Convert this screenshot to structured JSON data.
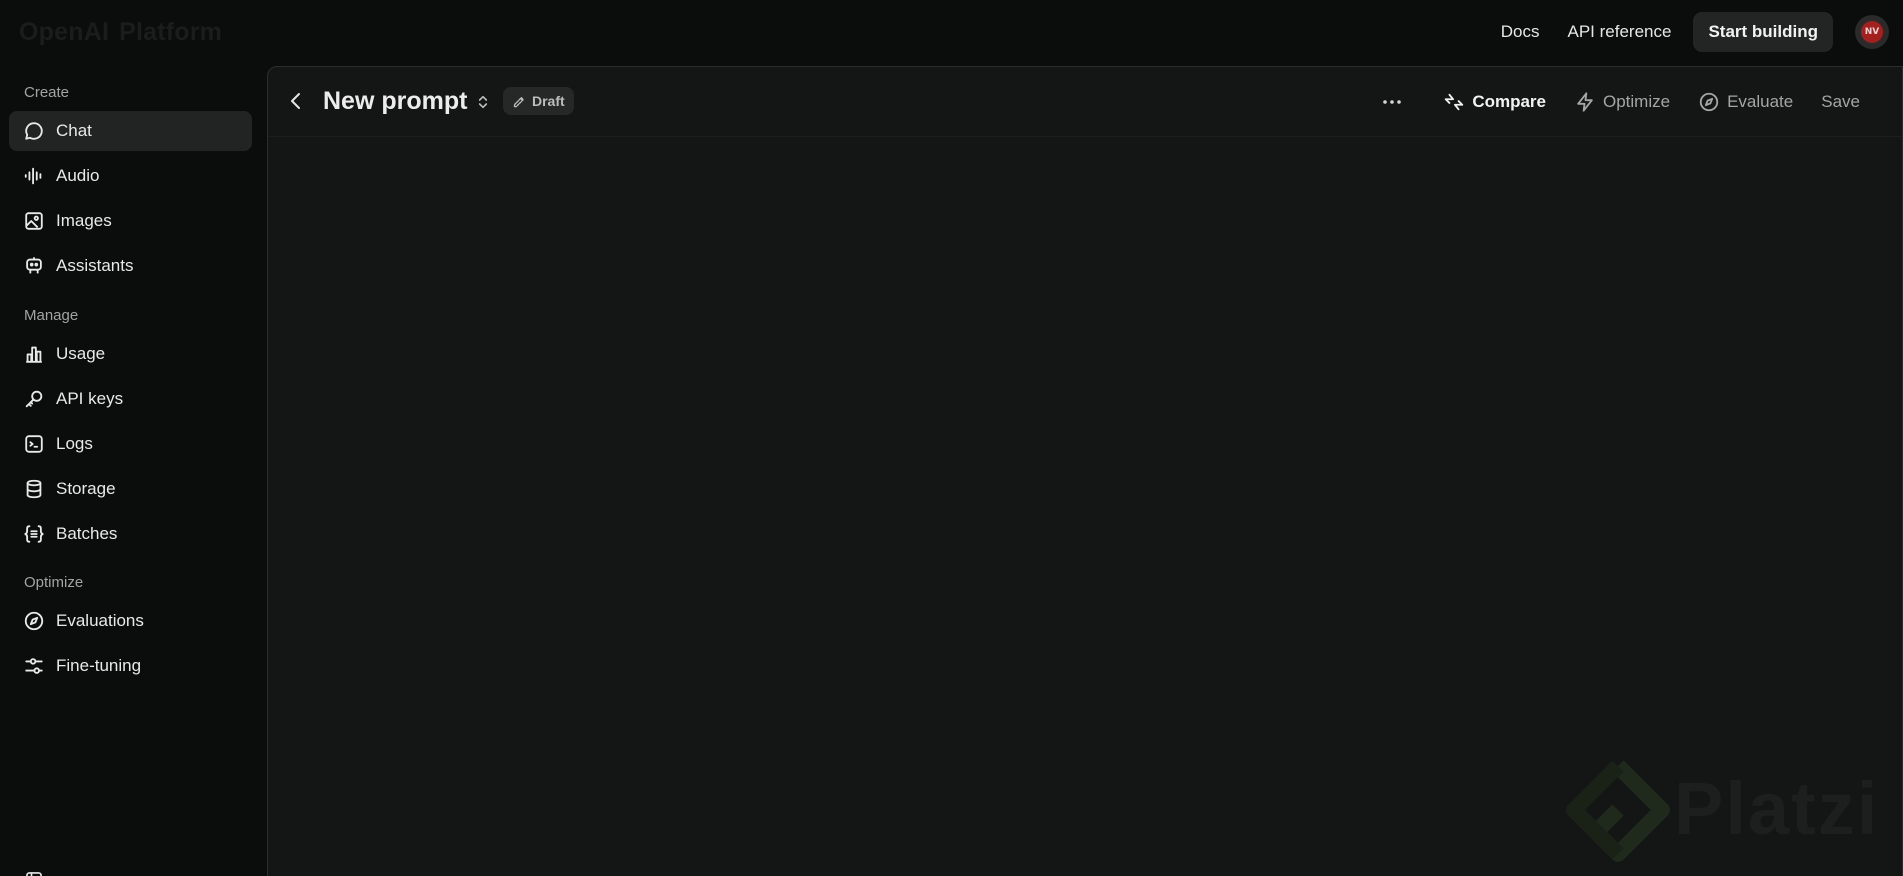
{
  "topbar": {
    "brand_left": "OpenAI",
    "brand_right": "Platform",
    "docs_label": "Docs",
    "api_reference_label": "API reference",
    "start_building_label": "Start building",
    "avatar_initials": "NV"
  },
  "sidebar": {
    "sections": {
      "create": "Create",
      "manage": "Manage",
      "optimize": "Optimize"
    },
    "items": {
      "chat": "Chat",
      "audio": "Audio",
      "images": "Images",
      "assistants": "Assistants",
      "usage": "Usage",
      "api_keys": "API keys",
      "logs": "Logs",
      "storage": "Storage",
      "batches": "Batches",
      "evaluations": "Evaluations",
      "fine_tuning": "Fine-tuning"
    },
    "active_item": "chat"
  },
  "prompt_header": {
    "title": "New prompt",
    "status_badge": "Draft",
    "compare_label": "Compare",
    "optimize_label": "Optimize",
    "evaluate_label": "Evaluate",
    "save_label": "Save"
  },
  "watermark": {
    "text": "Platzi"
  },
  "colors": {
    "background": "#0b0c0c",
    "panel": "#141515",
    "active_nav": "#222424",
    "avatar_red": "#a3201f"
  }
}
